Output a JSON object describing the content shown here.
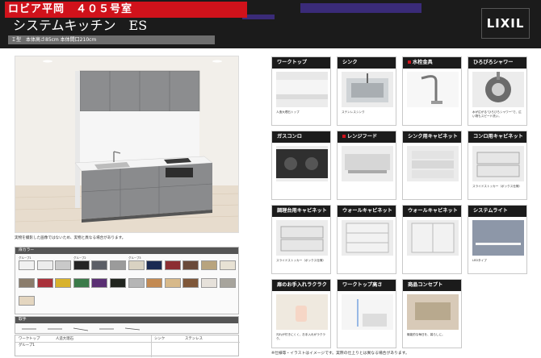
{
  "header": {
    "title": "ロビア平岡　４０５号室",
    "product": "システムキッチン　ES",
    "dims": "Ｉ型　本体高さ85cm 本体間口210cm",
    "brand": "LIXIL"
  },
  "main": {
    "note": "実物を撮影した画像ではないため、実物と異なる場合があります。",
    "note2": "",
    "color_panel_title": "扉カラー",
    "group_labels": [
      "グループ1",
      "グループ2",
      "グループ3",
      ""
    ],
    "swatches": [
      {
        "color": "#f1f1f1",
        "label": ""
      },
      {
        "color": "#ececec",
        "label": ""
      },
      {
        "color": "#c9c9c9",
        "label": ""
      },
      {
        "color": "#242424",
        "label": ""
      },
      {
        "color": "#5b5e66",
        "label": ""
      },
      {
        "color": "#9b9b9b",
        "label": ""
      },
      {
        "color": "#d9d2c2",
        "label": ""
      },
      {
        "color": "#1b2a52",
        "label": ""
      },
      {
        "color": "#8c2e32",
        "label": ""
      },
      {
        "color": "#6a4a3a",
        "label": ""
      },
      {
        "color": "#b8a47f",
        "label": ""
      },
      {
        "color": "#e8e2d4",
        "label": ""
      },
      {
        "color": "#8a7c6b",
        "label": ""
      },
      {
        "color": "#a9313a",
        "label": ""
      },
      {
        "color": "#d8b22c",
        "label": ""
      },
      {
        "color": "#3a7a49",
        "label": ""
      },
      {
        "color": "#5a2f73",
        "label": ""
      },
      {
        "color": "#21251f",
        "label": ""
      },
      {
        "color": "#b5b5b5",
        "label": ""
      },
      {
        "color": "#c38a52",
        "label": ""
      },
      {
        "color": "#d7b98a",
        "label": ""
      },
      {
        "color": "#7f5739",
        "label": ""
      },
      {
        "color": "#e6e1da",
        "label": ""
      },
      {
        "color": "#a7a49c",
        "label": ""
      },
      {
        "color": "#e4d6c0",
        "label": ""
      }
    ],
    "handle_title": "取手",
    "bottom_table": {
      "col1": "ワークトップ",
      "col1_val": "人造大理石",
      "col2": "シンク",
      "col2_val": "ステンレス",
      "group": "グループ1"
    }
  },
  "cards": [
    {
      "title": "ワークトップ",
      "cap": "人造大理石トップ",
      "cap2": "",
      "accent": false
    },
    {
      "title": "シンク",
      "cap": "ステンレスシンク",
      "cap2": "",
      "accent": false
    },
    {
      "title": "水栓金具",
      "cap": "",
      "cap2": "",
      "accent": true
    },
    {
      "title": "ひろびろシャワー",
      "cap": "水が広がる\"ひろびろシャワー\"で、広い物もスピード洗い。",
      "cap2": "",
      "accent": false
    },
    {
      "title": "ガスコンロ",
      "cap": "",
      "cap2": "",
      "accent": false
    },
    {
      "title": "レンジフード",
      "cap": "",
      "cap2": "",
      "accent": true
    },
    {
      "title": "シンク用キャビネット",
      "cap": "",
      "cap2": "",
      "accent": false
    },
    {
      "title": "コンロ用キャビネット",
      "cap": "スライドストッカー（ボックス仕様）",
      "cap2": "",
      "accent": false
    },
    {
      "title": "調理台用キャビネット",
      "cap": "スライドストッカー（ボックス仕様）",
      "cap2": "",
      "accent": false
    },
    {
      "title": "ウォールキャビネット",
      "cap": "",
      "cap2": "",
      "accent": false
    },
    {
      "title": "ウォールキャビネット",
      "cap": "",
      "cap2": "",
      "accent": false
    },
    {
      "title": "システムライト",
      "cap": "LEDタイプ",
      "cap2": "",
      "accent": false
    },
    {
      "title": "扉のお手入れラクラク",
      "cap": "汚れが付きにくく、お手入れがラクラク。",
      "cap2": "",
      "accent": false
    },
    {
      "title": "ワークトップ高さ",
      "cap": "",
      "cap2": "",
      "accent": false
    },
    {
      "title": "商品コンセプト",
      "cap": "機能的な毎日を、暮らしに。",
      "cap2": "",
      "accent": false
    }
  ],
  "footnote": "※仕様等・イラストはイメージです。実際の仕上りとは異なる場合があります。"
}
